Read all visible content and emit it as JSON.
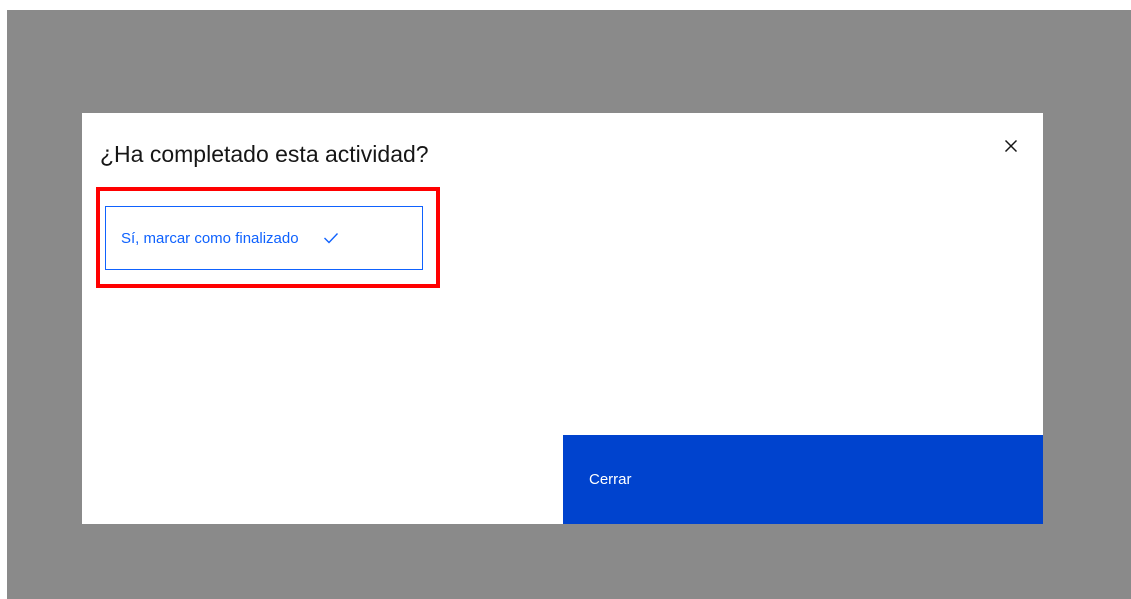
{
  "modal": {
    "title": "¿Ha completado esta actividad?",
    "complete_button_label": "Sí, marcar como finalizado",
    "close_button_label": "Cerrar"
  },
  "icons": {
    "close": "close-icon",
    "check": "checkmark-icon"
  },
  "colors": {
    "overlay": "#8a8a8a",
    "primary": "#0043ce",
    "link_blue": "#0f62fe",
    "highlight": "#ff0000",
    "title_text": "#161616"
  }
}
